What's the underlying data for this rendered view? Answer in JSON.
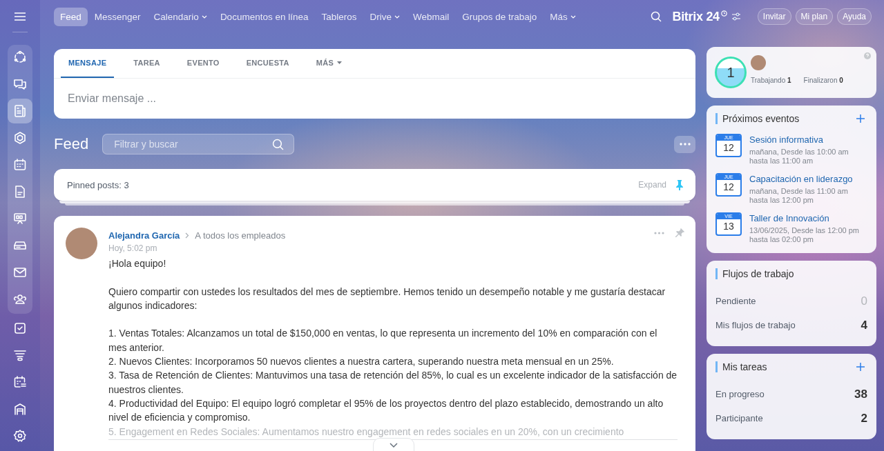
{
  "sidebar": {
    "pinned_items": [
      {
        "kind": "flow",
        "selected": false
      },
      {
        "kind": "chat",
        "selected": false
      },
      {
        "kind": "feed",
        "selected": true
      },
      {
        "kind": "hexagon",
        "selected": false
      },
      {
        "kind": "calendar",
        "selected": false
      },
      {
        "kind": "document",
        "selected": false
      },
      {
        "kind": "board",
        "selected": false
      },
      {
        "kind": "drive",
        "selected": false
      },
      {
        "kind": "mail",
        "selected": false
      },
      {
        "kind": "people",
        "selected": false
      }
    ],
    "other_items": [
      {
        "kind": "task",
        "selected": false
      },
      {
        "kind": "funnel",
        "selected": false
      },
      {
        "kind": "schedule",
        "selected": false
      },
      {
        "kind": "warehouse",
        "selected": false
      },
      {
        "kind": "settings",
        "selected": false
      }
    ]
  },
  "top_nav": {
    "items": [
      {
        "label": "Feed",
        "selected": true,
        "has_menu": false
      },
      {
        "label": "Messenger",
        "selected": false,
        "has_menu": false
      },
      {
        "label": "Calendario",
        "selected": false,
        "has_menu": true
      },
      {
        "label": "Documentos en línea",
        "selected": false,
        "has_menu": false
      },
      {
        "label": "Tableros",
        "selected": false,
        "has_menu": false
      },
      {
        "label": "Drive",
        "selected": false,
        "has_menu": true
      },
      {
        "label": "Webmail",
        "selected": false,
        "has_menu": false
      },
      {
        "label": "Grupos de trabajo",
        "selected": false,
        "has_menu": false
      },
      {
        "label": "Más",
        "selected": false,
        "has_menu": true
      }
    ],
    "logo": {
      "name": "Bitrix",
      "number": "24"
    },
    "buttons": [
      "Invitar",
      "Mi plan",
      "Ayuda"
    ]
  },
  "composer": {
    "tabs": [
      {
        "label": "MENSAJE",
        "selected": true,
        "has_menu": false
      },
      {
        "label": "TAREA",
        "selected": false,
        "has_menu": false
      },
      {
        "label": "EVENTO",
        "selected": false,
        "has_menu": false
      },
      {
        "label": "ENCUESTA",
        "selected": false,
        "has_menu": false
      },
      {
        "label": "MÁS",
        "selected": false,
        "has_menu": true
      }
    ],
    "placeholder": "Enviar mensaje ..."
  },
  "feed": {
    "title": "Feed",
    "search_placeholder": "Filtrar y buscar"
  },
  "pinned": {
    "label": "Pinned posts:",
    "count": "3",
    "expand": "Expand"
  },
  "post": {
    "author": "Alejandra García",
    "recipients": "A todos los empleados",
    "time": "Hoy, 5:02 pm",
    "paragraphs": [
      [
        "¡Hola equipo!"
      ],
      [
        "Quiero compartir con ustedes los resultados del mes de septiembre. Hemos tenido un desempeño notable y me gustaría destacar algunos indicadores:"
      ],
      [
        "1. Ventas Totales: Alcanzamos un total de $150,000 en ventas, lo que representa un incremento del 10% en comparación con el mes anterior.",
        "2. Nuevos Clientes: Incorporamos 50 nuevos clientes a nuestra cartera, superando nuestra meta mensual en un 25%.",
        "3. Tasa de Retención de Clientes: Mantuvimos una tasa de retención del 85%, lo cual es un excelente indicador de la satisfacción de nuestros clientes.",
        "4. Productividad del Equipo: El equipo logró completar el 95% de los proyectos dentro del plazo establecido, demostrando un alto nivel de eficiencia y compromiso.",
        "5. Engagement en Redes Sociales: Aumentamos nuestro engagement en redes sociales en un 20%, con un crecimiento"
      ]
    ]
  },
  "worktime": {
    "count": "1",
    "stats": [
      {
        "label": "Trabajando",
        "value": "1"
      },
      {
        "label": "Finalizaron",
        "value": "0"
      }
    ]
  },
  "events": {
    "title": "Próximos eventos",
    "items": [
      {
        "weekday": "JUE",
        "day": "12",
        "title": "Sesión informativa",
        "when": "mañana, Desde las 10:00 am hasta las 11:00 am"
      },
      {
        "weekday": "JUE",
        "day": "12",
        "title": "Capacitación en liderazgo",
        "when": "mañana, Desde las 11:00 am hasta las 12:00 pm"
      },
      {
        "weekday": "VIE",
        "day": "13",
        "title": "Taller de Innovación",
        "when": "13/06/2025, Desde las 12:00 pm hasta las 02:00 pm"
      }
    ]
  },
  "workflows": {
    "title": "Flujos de trabajo",
    "rows": [
      {
        "label": "Pendiente",
        "value": "0",
        "zero": true
      },
      {
        "label": "Mis flujos de trabajo",
        "value": "4",
        "zero": false
      }
    ]
  },
  "tasks": {
    "title": "Mis tareas",
    "rows": [
      {
        "label": "En progreso",
        "value": "38",
        "zero": false
      },
      {
        "label": "Participante",
        "value": "2",
        "zero": false
      }
    ]
  }
}
